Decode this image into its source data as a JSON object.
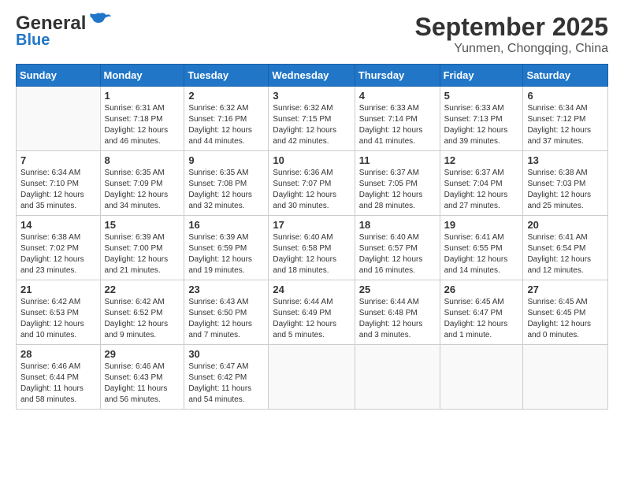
{
  "header": {
    "logo_general": "General",
    "logo_blue": "Blue",
    "month": "September 2025",
    "location": "Yunmen, Chongqing, China"
  },
  "weekdays": [
    "Sunday",
    "Monday",
    "Tuesday",
    "Wednesday",
    "Thursday",
    "Friday",
    "Saturday"
  ],
  "weeks": [
    [
      {
        "day": "",
        "info": ""
      },
      {
        "day": "1",
        "info": "Sunrise: 6:31 AM\nSunset: 7:18 PM\nDaylight: 12 hours\nand 46 minutes."
      },
      {
        "day": "2",
        "info": "Sunrise: 6:32 AM\nSunset: 7:16 PM\nDaylight: 12 hours\nand 44 minutes."
      },
      {
        "day": "3",
        "info": "Sunrise: 6:32 AM\nSunset: 7:15 PM\nDaylight: 12 hours\nand 42 minutes."
      },
      {
        "day": "4",
        "info": "Sunrise: 6:33 AM\nSunset: 7:14 PM\nDaylight: 12 hours\nand 41 minutes."
      },
      {
        "day": "5",
        "info": "Sunrise: 6:33 AM\nSunset: 7:13 PM\nDaylight: 12 hours\nand 39 minutes."
      },
      {
        "day": "6",
        "info": "Sunrise: 6:34 AM\nSunset: 7:12 PM\nDaylight: 12 hours\nand 37 minutes."
      }
    ],
    [
      {
        "day": "7",
        "info": "Sunrise: 6:34 AM\nSunset: 7:10 PM\nDaylight: 12 hours\nand 35 minutes."
      },
      {
        "day": "8",
        "info": "Sunrise: 6:35 AM\nSunset: 7:09 PM\nDaylight: 12 hours\nand 34 minutes."
      },
      {
        "day": "9",
        "info": "Sunrise: 6:35 AM\nSunset: 7:08 PM\nDaylight: 12 hours\nand 32 minutes."
      },
      {
        "day": "10",
        "info": "Sunrise: 6:36 AM\nSunset: 7:07 PM\nDaylight: 12 hours\nand 30 minutes."
      },
      {
        "day": "11",
        "info": "Sunrise: 6:37 AM\nSunset: 7:05 PM\nDaylight: 12 hours\nand 28 minutes."
      },
      {
        "day": "12",
        "info": "Sunrise: 6:37 AM\nSunset: 7:04 PM\nDaylight: 12 hours\nand 27 minutes."
      },
      {
        "day": "13",
        "info": "Sunrise: 6:38 AM\nSunset: 7:03 PM\nDaylight: 12 hours\nand 25 minutes."
      }
    ],
    [
      {
        "day": "14",
        "info": "Sunrise: 6:38 AM\nSunset: 7:02 PM\nDaylight: 12 hours\nand 23 minutes."
      },
      {
        "day": "15",
        "info": "Sunrise: 6:39 AM\nSunset: 7:00 PM\nDaylight: 12 hours\nand 21 minutes."
      },
      {
        "day": "16",
        "info": "Sunrise: 6:39 AM\nSunset: 6:59 PM\nDaylight: 12 hours\nand 19 minutes."
      },
      {
        "day": "17",
        "info": "Sunrise: 6:40 AM\nSunset: 6:58 PM\nDaylight: 12 hours\nand 18 minutes."
      },
      {
        "day": "18",
        "info": "Sunrise: 6:40 AM\nSunset: 6:57 PM\nDaylight: 12 hours\nand 16 minutes."
      },
      {
        "day": "19",
        "info": "Sunrise: 6:41 AM\nSunset: 6:55 PM\nDaylight: 12 hours\nand 14 minutes."
      },
      {
        "day": "20",
        "info": "Sunrise: 6:41 AM\nSunset: 6:54 PM\nDaylight: 12 hours\nand 12 minutes."
      }
    ],
    [
      {
        "day": "21",
        "info": "Sunrise: 6:42 AM\nSunset: 6:53 PM\nDaylight: 12 hours\nand 10 minutes."
      },
      {
        "day": "22",
        "info": "Sunrise: 6:42 AM\nSunset: 6:52 PM\nDaylight: 12 hours\nand 9 minutes."
      },
      {
        "day": "23",
        "info": "Sunrise: 6:43 AM\nSunset: 6:50 PM\nDaylight: 12 hours\nand 7 minutes."
      },
      {
        "day": "24",
        "info": "Sunrise: 6:44 AM\nSunset: 6:49 PM\nDaylight: 12 hours\nand 5 minutes."
      },
      {
        "day": "25",
        "info": "Sunrise: 6:44 AM\nSunset: 6:48 PM\nDaylight: 12 hours\nand 3 minutes."
      },
      {
        "day": "26",
        "info": "Sunrise: 6:45 AM\nSunset: 6:47 PM\nDaylight: 12 hours\nand 1 minute."
      },
      {
        "day": "27",
        "info": "Sunrise: 6:45 AM\nSunset: 6:45 PM\nDaylight: 12 hours\nand 0 minutes."
      }
    ],
    [
      {
        "day": "28",
        "info": "Sunrise: 6:46 AM\nSunset: 6:44 PM\nDaylight: 11 hours\nand 58 minutes."
      },
      {
        "day": "29",
        "info": "Sunrise: 6:46 AM\nSunset: 6:43 PM\nDaylight: 11 hours\nand 56 minutes."
      },
      {
        "day": "30",
        "info": "Sunrise: 6:47 AM\nSunset: 6:42 PM\nDaylight: 11 hours\nand 54 minutes."
      },
      {
        "day": "",
        "info": ""
      },
      {
        "day": "",
        "info": ""
      },
      {
        "day": "",
        "info": ""
      },
      {
        "day": "",
        "info": ""
      }
    ]
  ]
}
